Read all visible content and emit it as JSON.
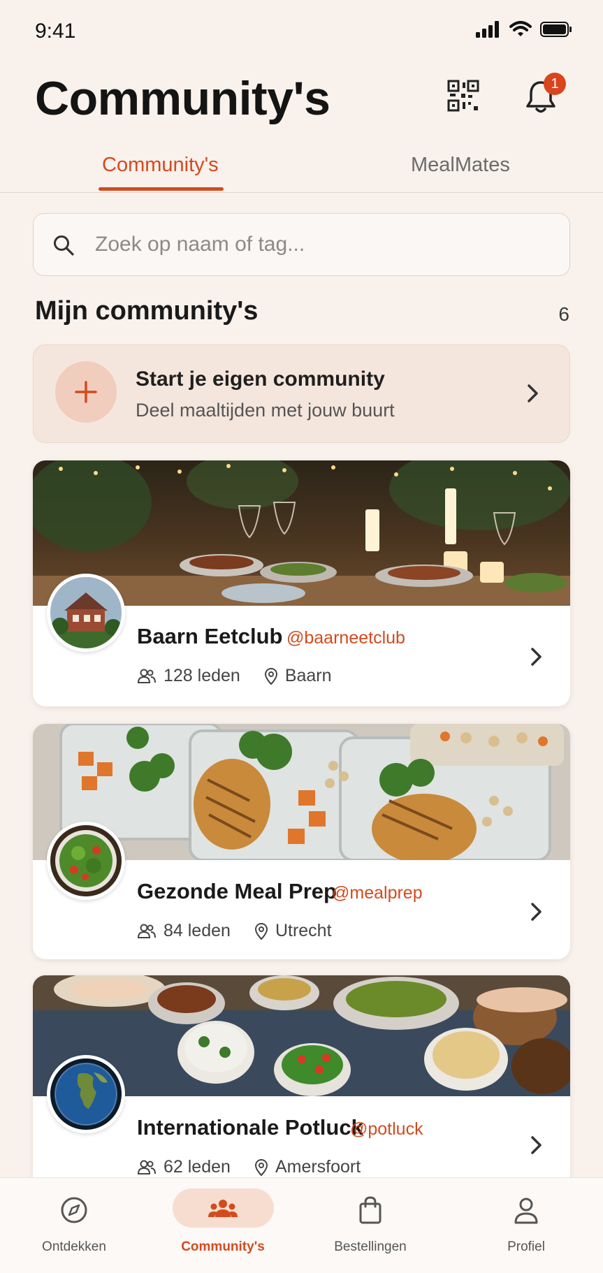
{
  "status": {
    "time": "9:41"
  },
  "header": {
    "title": "Community's",
    "notification_count": "1"
  },
  "tabs": [
    {
      "label": "Community's",
      "active": true
    },
    {
      "label": "MealMates",
      "active": false
    }
  ],
  "search": {
    "placeholder": "Zoek op naam of tag..."
  },
  "section": {
    "title": "Mijn community's",
    "count": "6"
  },
  "start_card": {
    "title": "Start je eigen community",
    "subtitle": "Deel maaltijden met jouw buurt"
  },
  "communities": [
    {
      "name": "Baarn Eetclub",
      "handle": "@baarneetclub",
      "members": "128 leden",
      "location": "Baarn"
    },
    {
      "name": "Gezonde Meal Prep",
      "handle": "@mealprep",
      "members": "84 leden",
      "location": "Utrecht"
    },
    {
      "name": "Internationale Potluck",
      "handle": "@potluck",
      "members": "62 leden",
      "location": "Amersfoort"
    }
  ],
  "nav": [
    {
      "label": "Ontdekken",
      "icon": "compass-icon",
      "active": false
    },
    {
      "label": "Community's",
      "icon": "people-icon",
      "active": true
    },
    {
      "label": "Bestellingen",
      "icon": "shopping-bag-icon",
      "active": false
    },
    {
      "label": "Profiel",
      "icon": "person-icon",
      "active": false
    }
  ],
  "colors": {
    "accent": "#d24b1f",
    "background": "#f8f1ec",
    "card": "#ffffff"
  }
}
